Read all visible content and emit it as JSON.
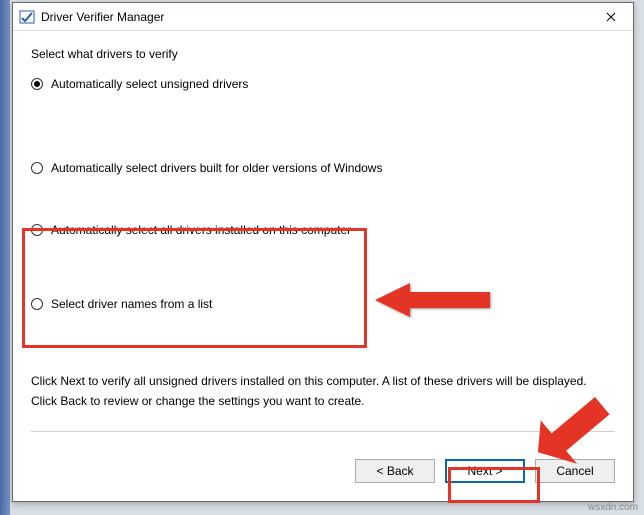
{
  "window": {
    "title": "Driver Verifier Manager",
    "close": "✕"
  },
  "section_label": "Select what drivers to verify",
  "options": {
    "opt1": "Automatically select unsigned drivers",
    "opt2": "Automatically select drivers built for older versions of Windows",
    "opt3": "Automatically select all drivers installed on this computer",
    "opt4": "Select driver names from a list"
  },
  "instructions": {
    "line1": "Click Next to verify all unsigned drivers installed on this computer. A list of these drivers will be displayed.",
    "line2": "Click Back to review or change the settings you want to create."
  },
  "buttons": {
    "back": "< Back",
    "next": "Next >",
    "cancel": "Cancel"
  },
  "watermark": "wsxdn.com",
  "icons": {
    "app": "verifier-icon",
    "close": "close-icon"
  },
  "colors": {
    "accent": "#0b66b5",
    "highlight": "#e33426"
  }
}
